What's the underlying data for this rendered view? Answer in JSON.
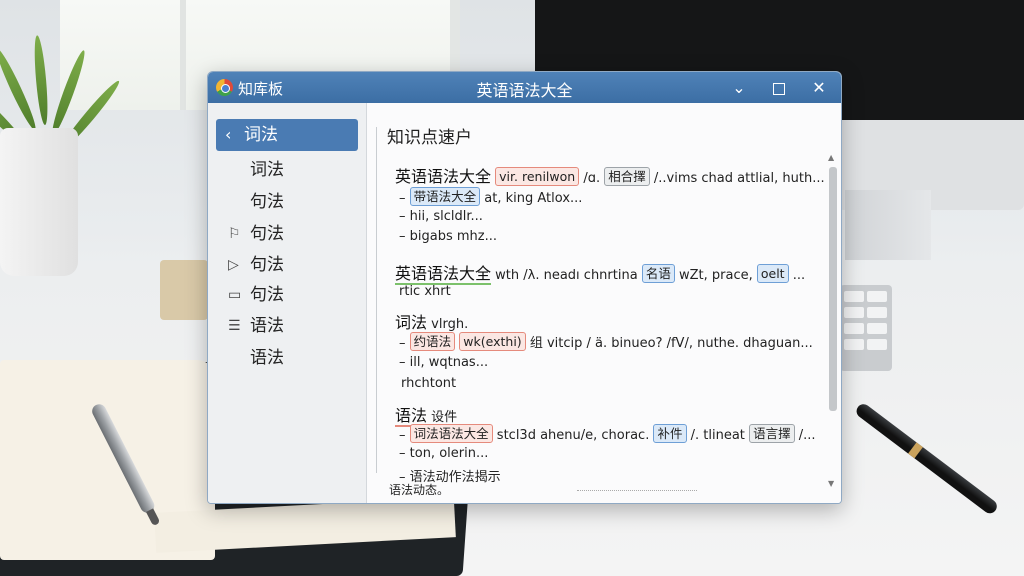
{
  "window": {
    "app_name": "知库板",
    "title": "英语语法大全",
    "minimize_symbol": "⌄",
    "close_symbol": "✕"
  },
  "sidebar": {
    "items": [
      {
        "label": "词法",
        "icon": "chevron-left-icon",
        "glyph": "‹",
        "active": true
      },
      {
        "label": "词法",
        "icon": "",
        "glyph": ""
      },
      {
        "label": "句法",
        "icon": "",
        "glyph": ""
      },
      {
        "label": "句法",
        "icon": "book-icon",
        "glyph": "⚐"
      },
      {
        "label": "句法",
        "icon": "play-icon",
        "glyph": "▷"
      },
      {
        "label": "句法",
        "icon": "folder-icon",
        "glyph": "▭"
      },
      {
        "label": "语法",
        "icon": "document-icon",
        "glyph": "☰"
      },
      {
        "label": "语法",
        "icon": "",
        "glyph": ""
      }
    ]
  },
  "content": {
    "title": "知识点速户",
    "sections": [
      {
        "heading": "英语语法大全",
        "tag1": "vir. renilwon",
        "text1": "/ɑ.",
        "tag2": "相合擇",
        "text2": "/..vims chad attlial, huth...",
        "line2_tag": "带语法大全",
        "line2_text": "at, king Atlox...",
        "line3": "hii, slcldlr...",
        "line4": "bigabs mhz..."
      },
      {
        "heading": "英语语法大全",
        "text1": "wth /λ. neadı chnrtina",
        "tag1": "名语",
        "text2": "wZt, prace,",
        "tag2": "oelt",
        "text3": "...",
        "line2": "rtic xhrt"
      },
      {
        "heading": "词法",
        "heading_suffix": "vlrgh.",
        "line2_tag": "约语法",
        "line2_text": "wk(exthi)",
        "line2_tag2": "组",
        "line2_text2": "vitcip / ä. binueo? /fV/, nuthe. dhaguan...",
        "line3": "ill, wqtnas...",
        "line4": "rhchtont"
      },
      {
        "heading": "语法",
        "heading_suffix": "设件",
        "line2_tag": "词法语法大全",
        "line2_text": "stcl3d ahenu/e, chorac.",
        "line2_tag2": "补件",
        "line2_text2": "/. tlineat",
        "line2_tag3": "语言擇",
        "line2_text3": "/...",
        "line3": "ton, olerin...",
        "line4": "语法动作法揭示"
      }
    ],
    "footer_text": "语法动态。"
  }
}
